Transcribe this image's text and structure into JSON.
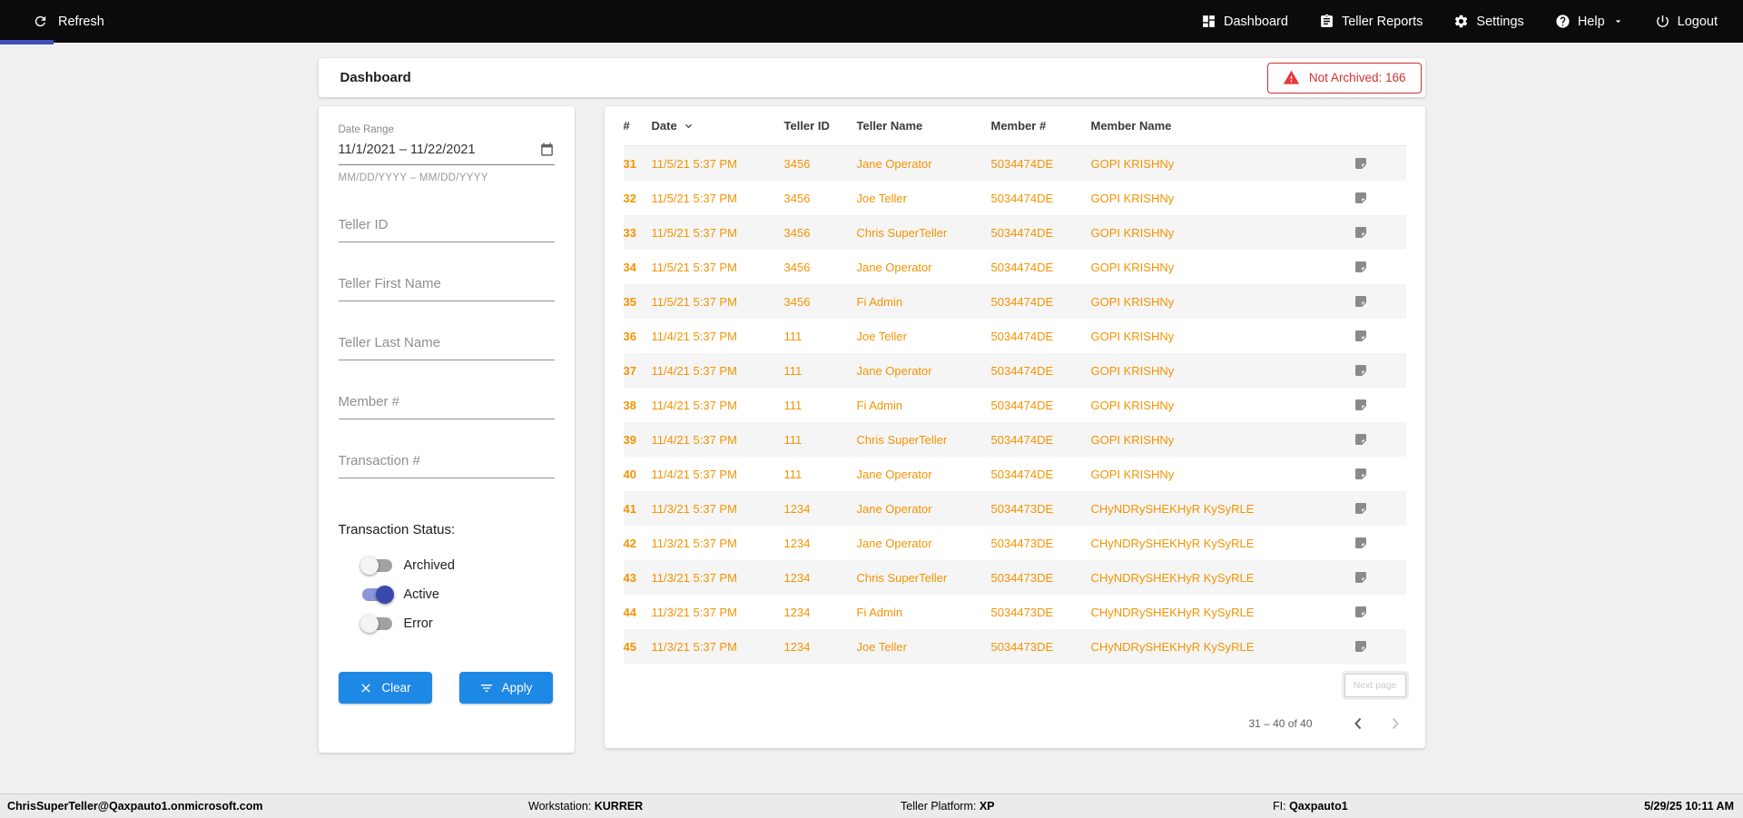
{
  "topbar": {
    "refresh_label": "Refresh",
    "nav": [
      {
        "label": "Dashboard",
        "icon": "dashboard-icon"
      },
      {
        "label": "Teller Reports",
        "icon": "teller-reports-icon"
      },
      {
        "label": "Settings",
        "icon": "settings-icon"
      },
      {
        "label": "Help",
        "icon": "help-icon",
        "has_dropdown": true
      },
      {
        "label": "Logout",
        "icon": "logout-icon"
      }
    ]
  },
  "page_header": {
    "title": "Dashboard",
    "not_archived_badge": "Not Archived: 166"
  },
  "filters": {
    "date_range": {
      "label": "Date Range",
      "value": "11/1/2021 – 11/22/2021",
      "hint": "MM/DD/YYYY – MM/DD/YYYY"
    },
    "teller_id": {
      "placeholder": "Teller ID",
      "value": ""
    },
    "teller_first_name": {
      "placeholder": "Teller First Name",
      "value": ""
    },
    "teller_last_name": {
      "placeholder": "Teller Last Name",
      "value": ""
    },
    "member_number": {
      "placeholder": "Member #",
      "value": ""
    },
    "transaction_number": {
      "placeholder": "Transaction #",
      "value": ""
    },
    "status_label": "Transaction Status:",
    "toggles": [
      {
        "label": "Archived",
        "on": false
      },
      {
        "label": "Active",
        "on": true
      },
      {
        "label": "Error",
        "on": false
      }
    ],
    "clear_label": "Clear",
    "apply_label": "Apply"
  },
  "table": {
    "columns": [
      "#",
      "Date",
      "Teller ID",
      "Teller Name",
      "Member #",
      "Member Name"
    ],
    "sorted_column": "Date",
    "rows": [
      {
        "num": "31",
        "date": "11/5/21 5:37 PM",
        "teller_id": "3456",
        "teller_name": "Jane Operator",
        "member_number": "5034474DE",
        "member_name": "GOPI KRISHNy"
      },
      {
        "num": "32",
        "date": "11/5/21 5:37 PM",
        "teller_id": "3456",
        "teller_name": "Joe Teller",
        "member_number": "5034474DE",
        "member_name": "GOPI KRISHNy"
      },
      {
        "num": "33",
        "date": "11/5/21 5:37 PM",
        "teller_id": "3456",
        "teller_name": "Chris SuperTeller",
        "member_number": "5034474DE",
        "member_name": "GOPI KRISHNy"
      },
      {
        "num": "34",
        "date": "11/5/21 5:37 PM",
        "teller_id": "3456",
        "teller_name": "Jane Operator",
        "member_number": "5034474DE",
        "member_name": "GOPI KRISHNy"
      },
      {
        "num": "35",
        "date": "11/5/21 5:37 PM",
        "teller_id": "3456",
        "teller_name": "Fi Admin",
        "member_number": "5034474DE",
        "member_name": "GOPI KRISHNy"
      },
      {
        "num": "36",
        "date": "11/4/21 5:37 PM",
        "teller_id": "111",
        "teller_name": "Joe Teller",
        "member_number": "5034474DE",
        "member_name": "GOPI KRISHNy"
      },
      {
        "num": "37",
        "date": "11/4/21 5:37 PM",
        "teller_id": "111",
        "teller_name": "Jane Operator",
        "member_number": "5034474DE",
        "member_name": "GOPI KRISHNy"
      },
      {
        "num": "38",
        "date": "11/4/21 5:37 PM",
        "teller_id": "111",
        "teller_name": "Fi Admin",
        "member_number": "5034474DE",
        "member_name": "GOPI KRISHNy"
      },
      {
        "num": "39",
        "date": "11/4/21 5:37 PM",
        "teller_id": "111",
        "teller_name": "Chris SuperTeller",
        "member_number": "5034474DE",
        "member_name": "GOPI KRISHNy"
      },
      {
        "num": "40",
        "date": "11/4/21 5:37 PM",
        "teller_id": "111",
        "teller_name": "Jane Operator",
        "member_number": "5034474DE",
        "member_name": "GOPI KRISHNy"
      },
      {
        "num": "41",
        "date": "11/3/21 5:37 PM",
        "teller_id": "1234",
        "teller_name": "Jane Operator",
        "member_number": "5034473DE",
        "member_name": "CHyNDRySHEKHyR KySyRLE"
      },
      {
        "num": "42",
        "date": "11/3/21 5:37 PM",
        "teller_id": "1234",
        "teller_name": "Jane Operator",
        "member_number": "5034473DE",
        "member_name": "CHyNDRySHEKHyR KySyRLE"
      },
      {
        "num": "43",
        "date": "11/3/21 5:37 PM",
        "teller_id": "1234",
        "teller_name": "Chris SuperTeller",
        "member_number": "5034473DE",
        "member_name": "CHyNDRySHEKHyR KySyRLE"
      },
      {
        "num": "44",
        "date": "11/3/21 5:37 PM",
        "teller_id": "1234",
        "teller_name": "Fi Admin",
        "member_number": "5034473DE",
        "member_name": "CHyNDRySHEKHyR KySyRLE"
      },
      {
        "num": "45",
        "date": "11/3/21 5:37 PM",
        "teller_id": "1234",
        "teller_name": "Joe Teller",
        "member_number": "5034473DE",
        "member_name": "CHyNDRySHEKHyR KySyRLE"
      }
    ],
    "next_page_label": "Next page",
    "range_label": "31 – 40 of 40"
  },
  "footer": {
    "user": "ChrisSuperTeller@Qaxpauto1.onmicrosoft.com",
    "workstation_label": "Workstation:",
    "workstation_value": "KURRER",
    "teller_platform_label": "Teller Platform:",
    "teller_platform_value": "XP",
    "fi_label": "FI:",
    "fi_value": "Qaxpauto1",
    "timestamp": "5/29/25 10:11 AM"
  },
  "colors": {
    "topbar_bg": "#0B0B0B",
    "tab_indicator": "#3F51B5",
    "accent_blue": "#1E88E5",
    "toggle_active": "#3949AB",
    "row_text_orange": "#F59300",
    "alert_red": "#D32F2F"
  }
}
